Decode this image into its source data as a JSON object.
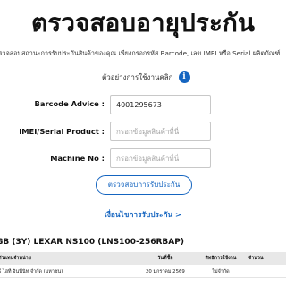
{
  "title": "ตรวจสอบอายุประกัน",
  "description": "ตรวจสอบสถานะการรับประกันสินค้าของคุณ เพียงกรอกรหัส Barcode, เลข IMEI หรือ Serial ผลิตภัณฑ์",
  "example_link": "ตัวอย่างการใช้งานคลิก",
  "info_icon_glyph": "i",
  "form": {
    "barcode_label": "Barcode Advice :",
    "barcode_value": "4001295673",
    "imei_label": "IMEI/Serial Product :",
    "imei_placeholder": "กรอกข้อมูลสินค้าที่นี่",
    "machine_label": "Machine No :",
    "machine_placeholder": "กรอกข้อมูลสินค้าที่นี่"
  },
  "check_button": "ตรวจสอบการรับประกัน",
  "terms_link": "เงื่อนไขการรับประกัน >",
  "product_name": "GB (3Y) LEXAR NS100 (LNS100-256RBAP)",
  "table": {
    "headers": [
      "ตัวแทนจำหน่าย",
      "วันที่ซื้อ",
      "สิทธิการใช้งาน",
      "จำนวน"
    ],
    "rows": [
      [
        "ธ์ ไฮที อินฟินิท จำกัด (มหาชน)",
        "20 มกราคม 2569",
        "ไม่จำกัด",
        ""
      ]
    ]
  },
  "colors": {
    "accent": "#1565c0",
    "text": "#111111",
    "table_header_bg": "#e8e8e8"
  }
}
